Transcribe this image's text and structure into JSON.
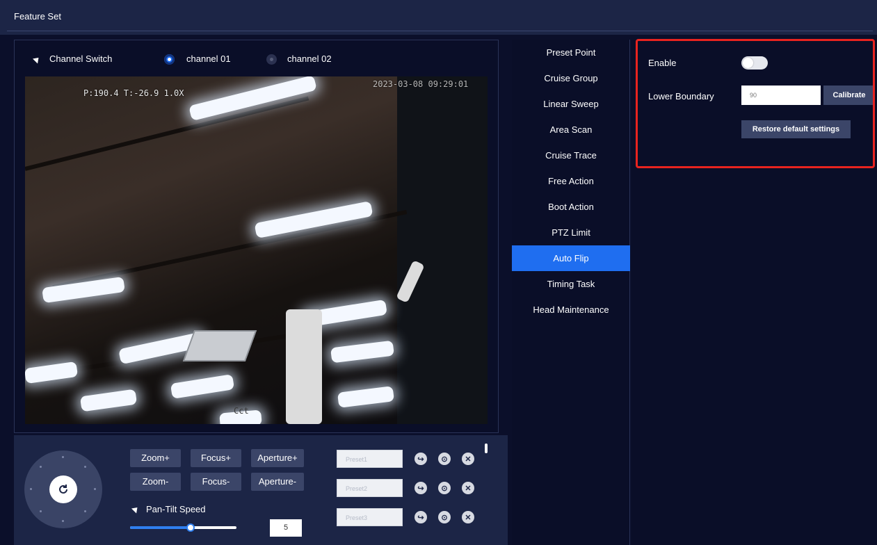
{
  "page": {
    "title": "Feature Set"
  },
  "channel": {
    "switch_label": "Channel Switch",
    "options": [
      {
        "label": "channel 01",
        "selected": true
      },
      {
        "label": "channel 02",
        "selected": false
      }
    ]
  },
  "video": {
    "ptz_readout": "P:190.4 T:-26.9 1.0X",
    "timestamp": "2023-03-08 09:29:01",
    "watermark": "Cct"
  },
  "controls": {
    "zoom_plus": "Zoom+",
    "focus_plus": "Focus+",
    "aperture_plus": "Aperture+",
    "zoom_minus": "Zoom-",
    "focus_minus": "Focus-",
    "aperture_minus": "Aperture-",
    "speed_label": "Pan-Tilt Speed",
    "speed_value": "5",
    "speed_level": 0.57,
    "presets": [
      {
        "placeholder": "Preset1"
      },
      {
        "placeholder": "Preset2"
      },
      {
        "placeholder": "Preset3"
      }
    ]
  },
  "menu": {
    "items": [
      {
        "label": "Preset Point"
      },
      {
        "label": "Cruise Group"
      },
      {
        "label": "Linear Sweep"
      },
      {
        "label": "Area Scan"
      },
      {
        "label": "Cruise Trace"
      },
      {
        "label": "Free Action"
      },
      {
        "label": "Boot Action"
      },
      {
        "label": "PTZ Limit"
      },
      {
        "label": "Auto Flip",
        "active": true
      },
      {
        "label": "Timing Task"
      },
      {
        "label": "Head Maintenance"
      }
    ]
  },
  "settings": {
    "enable_label": "Enable",
    "enable_on": false,
    "lower_boundary_label": "Lower Boundary",
    "lower_boundary_value": "90",
    "calibrate_label": "Calibrate",
    "restore_label": "Restore default settings"
  },
  "colors": {
    "accent": "#1f6ef0",
    "highlight_border": "#e8231f",
    "panel_bg": "#0a0e28",
    "header_bg": "#1c2546"
  }
}
